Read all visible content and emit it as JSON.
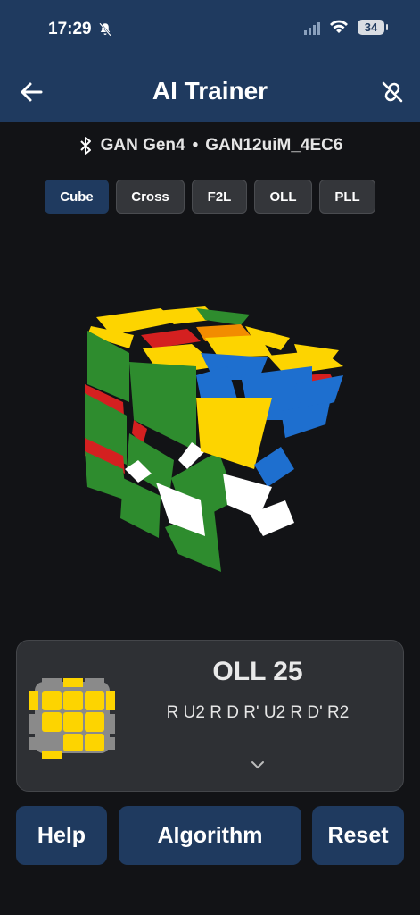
{
  "status": {
    "time": "17:29",
    "battery": "34"
  },
  "header": {
    "title": "AI Trainer"
  },
  "device": {
    "name": "GAN Gen4",
    "separator": "•",
    "id": "GAN12uiM_4EC6"
  },
  "tabs": [
    {
      "label": "Cube",
      "active": true
    },
    {
      "label": "Cross"
    },
    {
      "label": "F2L"
    },
    {
      "label": "OLL"
    },
    {
      "label": "PLL"
    }
  ],
  "case": {
    "name": "OLL 25",
    "algorithm": "R U2 R D R' U2 R D' R2"
  },
  "buttons": {
    "help": "Help",
    "algorithm": "Algorithm",
    "reset": "Reset"
  },
  "colors": {
    "accent": "#1f3a5f",
    "yellow": "#fdd400",
    "green": "#2e8c2e",
    "red": "#d42020",
    "blue": "#1e6fcf",
    "orange": "#f28c00",
    "white": "#ffffff",
    "gray": "#8a8a8a"
  }
}
